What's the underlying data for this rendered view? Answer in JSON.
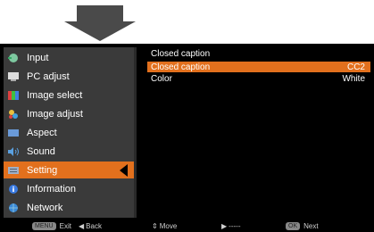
{
  "menu": {
    "items": [
      {
        "label": "Input",
        "icon": "input-icon",
        "color": "#7ec8a0"
      },
      {
        "label": "PC adjust",
        "icon": "pc-adjust-icon",
        "color": "#dddddd"
      },
      {
        "label": "Image select",
        "icon": "image-select-icon",
        "color": "#6aa0e8"
      },
      {
        "label": "Image adjust",
        "icon": "image-adjust-icon",
        "color": "#e8c040"
      },
      {
        "label": "Aspect",
        "icon": "aspect-icon",
        "color": "#6a9ad8"
      },
      {
        "label": "Sound",
        "icon": "sound-icon",
        "color": "#5aa0e0"
      },
      {
        "label": "Setting",
        "icon": "setting-icon",
        "color": "#a0b0c8"
      },
      {
        "label": "Information",
        "icon": "information-icon",
        "color": "#3a7ae0"
      },
      {
        "label": "Network",
        "icon": "network-icon",
        "color": "#3a8ad8"
      }
    ],
    "selected_index": 6,
    "accent": "#e2701d"
  },
  "panel": {
    "title": "Closed caption",
    "rows": [
      {
        "label": "Closed caption",
        "value": "CC2"
      },
      {
        "label": "Color",
        "value": "White"
      }
    ]
  },
  "footer": {
    "exit": {
      "key": "MENU",
      "label": "Exit"
    },
    "back": {
      "glyph": "◀",
      "label": "Back"
    },
    "move": {
      "glyph": "⇕",
      "label": "Move"
    },
    "next_dash": {
      "glyph": "▶",
      "label": "-----"
    },
    "next": {
      "key": "OK",
      "label": "Next"
    }
  }
}
